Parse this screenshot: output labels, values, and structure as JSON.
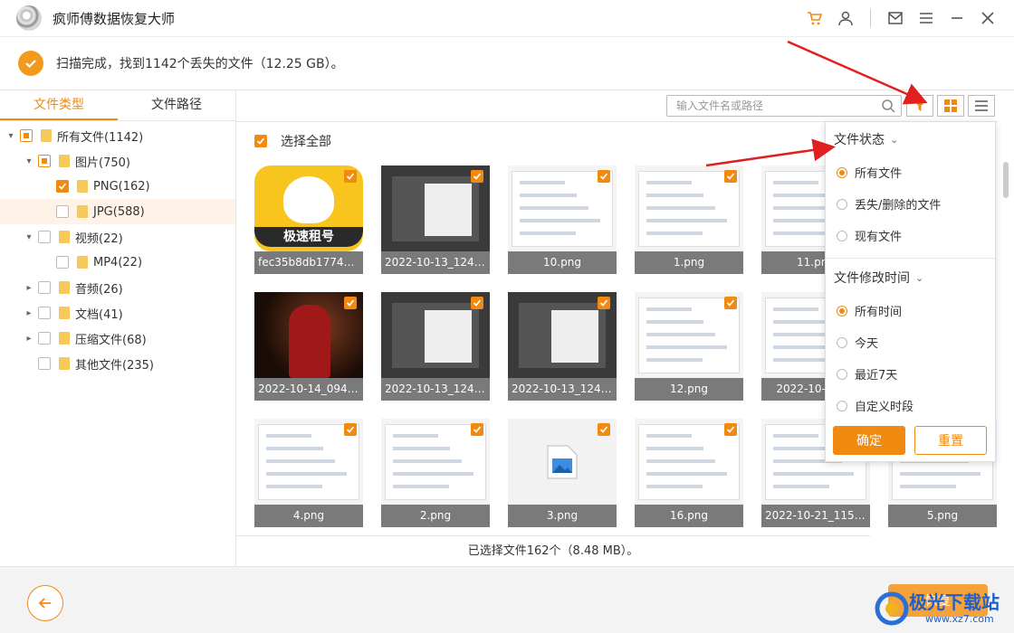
{
  "app": {
    "title": "疯师傅数据恢复大师"
  },
  "titlebar": {
    "icons": [
      "cart-icon",
      "user-icon",
      "mail-icon",
      "menu-icon",
      "minimize-icon",
      "close-icon"
    ]
  },
  "status": {
    "message": "扫描完成，找到1142个丢失的文件（12.25 GB）。"
  },
  "sidebar": {
    "tabs": [
      {
        "label": "文件类型",
        "active": true
      },
      {
        "label": "文件路径",
        "active": false
      }
    ],
    "tree": [
      {
        "label": "所有文件(1142)",
        "level": 0,
        "arrow": "down",
        "check": "partial"
      },
      {
        "label": "图片(750)",
        "level": 1,
        "arrow": "down",
        "check": "partial"
      },
      {
        "label": "PNG(162)",
        "level": 2,
        "arrow": "",
        "check": "checked"
      },
      {
        "label": "JPG(588)",
        "level": 2,
        "arrow": "",
        "check": "none",
        "selected": true
      },
      {
        "label": "视频(22)",
        "level": 1,
        "arrow": "down",
        "check": "none"
      },
      {
        "label": "MP4(22)",
        "level": 2,
        "arrow": "",
        "check": "none"
      },
      {
        "label": "音频(26)",
        "level": 1,
        "arrow": "right",
        "check": "none"
      },
      {
        "label": "文档(41)",
        "level": 1,
        "arrow": "right",
        "check": "none"
      },
      {
        "label": "压缩文件(68)",
        "level": 1,
        "arrow": "right",
        "check": "none"
      },
      {
        "label": "其他文件(235)",
        "level": 1,
        "arrow": "",
        "check": "none"
      }
    ]
  },
  "toolbar": {
    "search_placeholder": "输入文件名或路径"
  },
  "select_all": {
    "label": "选择全部"
  },
  "files": [
    {
      "name": "fec35b8db1774d3...",
      "style": "app-icon"
    },
    {
      "name": "2022-10-13_12403...",
      "style": "dark"
    },
    {
      "name": "10.png",
      "style": "light"
    },
    {
      "name": "1.png",
      "style": "light"
    },
    {
      "name": "11.png",
      "style": "light"
    },
    {
      "name": "2022-10-14_09481...",
      "style": "photo"
    },
    {
      "name": "2022-10-13_12405...",
      "style": "dark"
    },
    {
      "name": "2022-10-13_12410...",
      "style": "dark"
    },
    {
      "name": "12.png",
      "style": "light"
    },
    {
      "name": "2022-10-13_...",
      "style": "light"
    },
    {
      "name": "4.png",
      "style": "light"
    },
    {
      "name": "2.png",
      "style": "light"
    },
    {
      "name": "3.png",
      "style": "placeholder"
    },
    {
      "name": "16.png",
      "style": "light"
    },
    {
      "name": "2022-10-21_11563...",
      "style": "light"
    },
    {
      "name": "5.png",
      "style": "light"
    }
  ],
  "thumb_texts": {
    "app_icon_caption": "极速租号"
  },
  "selection_status": "已选择文件162个（8.48 MB）。",
  "filter": {
    "status_title": "文件状态",
    "status_options": [
      {
        "label": "所有文件",
        "selected": true
      },
      {
        "label": "丢失/删除的文件",
        "selected": false
      },
      {
        "label": "现有文件",
        "selected": false
      }
    ],
    "time_title": "文件修改时间",
    "time_options": [
      {
        "label": "所有时间",
        "selected": true
      },
      {
        "label": "今天",
        "selected": false
      },
      {
        "label": "最近7天",
        "selected": false
      },
      {
        "label": "自定义时段",
        "selected": false
      }
    ],
    "ok_label": "确定",
    "reset_label": "重置"
  },
  "footer": {
    "recover_label": "恢复"
  },
  "watermark": {
    "brand": "极光下载站",
    "url": "www.xz7.com"
  },
  "colors": {
    "accent": "#f08a10",
    "annotation_arrow": "#e02020"
  }
}
